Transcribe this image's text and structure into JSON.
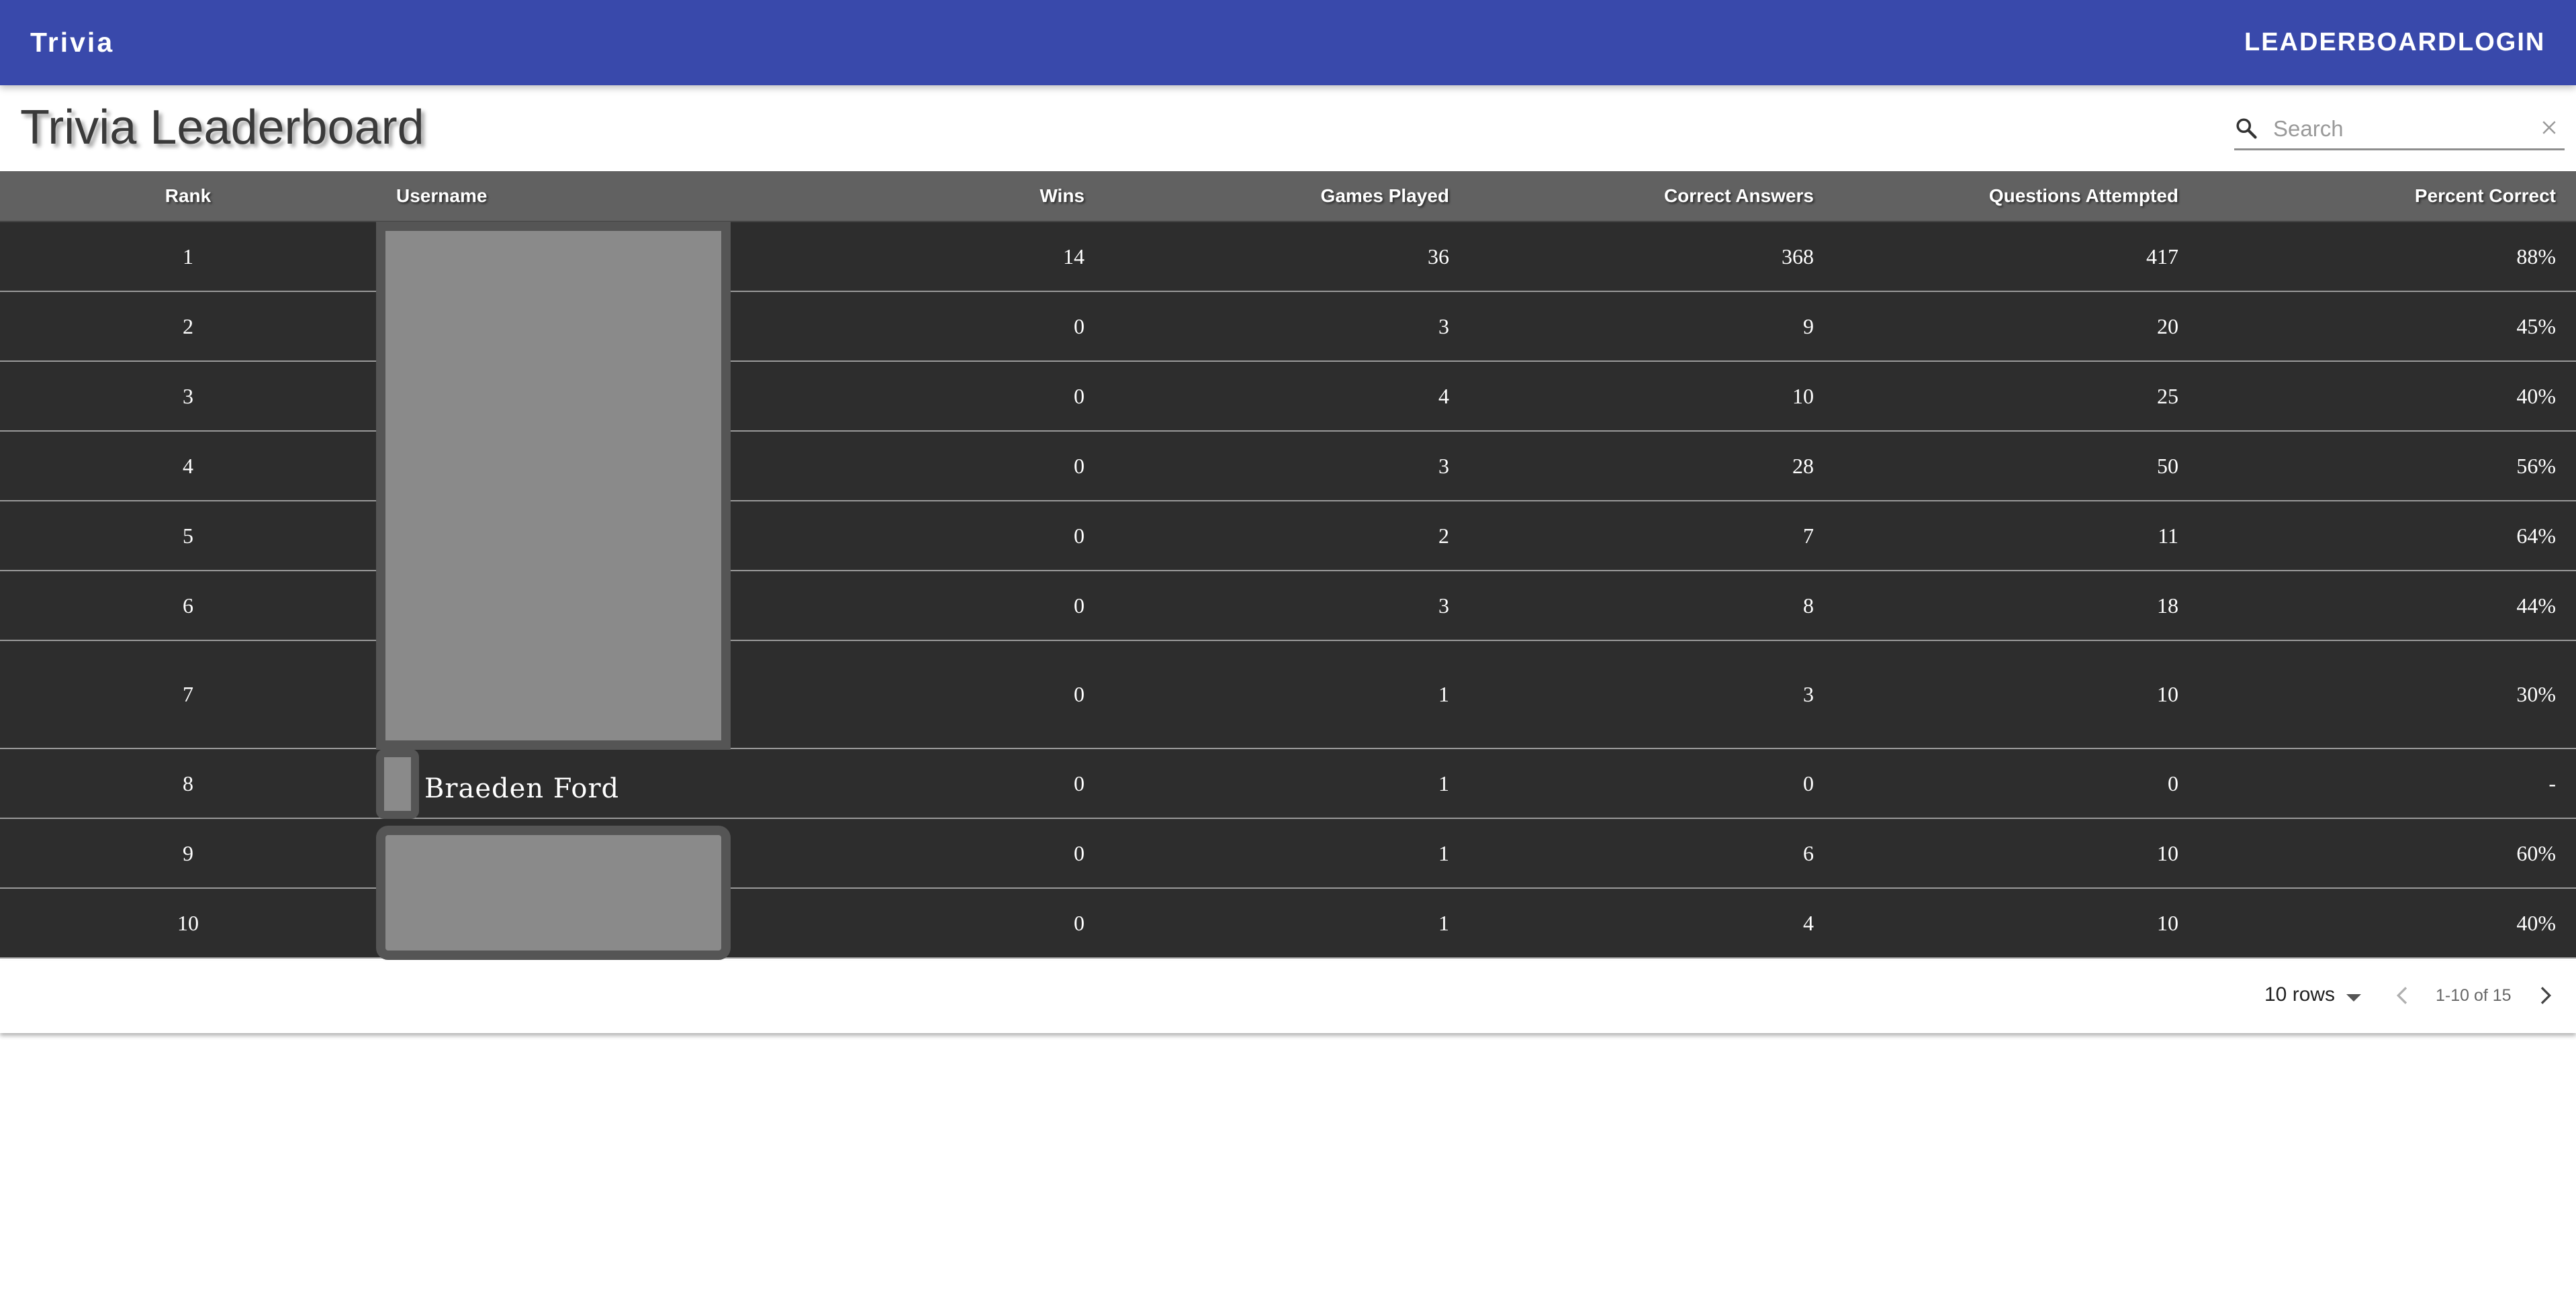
{
  "app": {
    "title": "Trivia",
    "nav": [
      "LEADERBOARD",
      "LOGIN"
    ],
    "accent_color": "#3949ab"
  },
  "page": {
    "title": "Trivia Leaderboard"
  },
  "search": {
    "placeholder": "Search",
    "icon": "search-icon",
    "clear_icon": "close-icon"
  },
  "table": {
    "columns": [
      "Rank",
      "Username",
      "Wins",
      "Games Played",
      "Correct Answers",
      "Questions Attempted",
      "Percent Correct"
    ],
    "rows": [
      {
        "rank": "1",
        "username": "",
        "wins": "14",
        "games_played": "36",
        "correct_answers": "368",
        "questions_attempted": "417",
        "percent_correct": "88%"
      },
      {
        "rank": "2",
        "username": "",
        "wins": "0",
        "games_played": "3",
        "correct_answers": "9",
        "questions_attempted": "20",
        "percent_correct": "45%"
      },
      {
        "rank": "3",
        "username": "",
        "wins": "0",
        "games_played": "4",
        "correct_answers": "10",
        "questions_attempted": "25",
        "percent_correct": "40%"
      },
      {
        "rank": "4",
        "username": "",
        "wins": "0",
        "games_played": "3",
        "correct_answers": "28",
        "questions_attempted": "50",
        "percent_correct": "56%"
      },
      {
        "rank": "5",
        "username": "",
        "wins": "0",
        "games_played": "2",
        "correct_answers": "7",
        "questions_attempted": "11",
        "percent_correct": "64%"
      },
      {
        "rank": "6",
        "username": "",
        "wins": "0",
        "games_played": "3",
        "correct_answers": "8",
        "questions_attempted": "18",
        "percent_correct": "44%"
      },
      {
        "rank": "7",
        "username": "",
        "wins": "0",
        "games_played": "1",
        "correct_answers": "3",
        "questions_attempted": "10",
        "percent_correct": "30%"
      },
      {
        "rank": "8",
        "username": "Braeden Ford",
        "wins": "0",
        "games_played": "1",
        "correct_answers": "0",
        "questions_attempted": "0",
        "percent_correct": "-"
      },
      {
        "rank": "9",
        "username": "",
        "wins": "0",
        "games_played": "1",
        "correct_answers": "6",
        "questions_attempted": "10",
        "percent_correct": "60%"
      },
      {
        "rank": "10",
        "username": "",
        "wins": "0",
        "games_played": "1",
        "correct_answers": "4",
        "questions_attempted": "10",
        "percent_correct": "40%"
      }
    ]
  },
  "pagination": {
    "rows_per_page": "10 rows",
    "range": "1-10 of 15",
    "prev_icon": "chevron-left-icon",
    "next_icon": "chevron-right-icon"
  }
}
